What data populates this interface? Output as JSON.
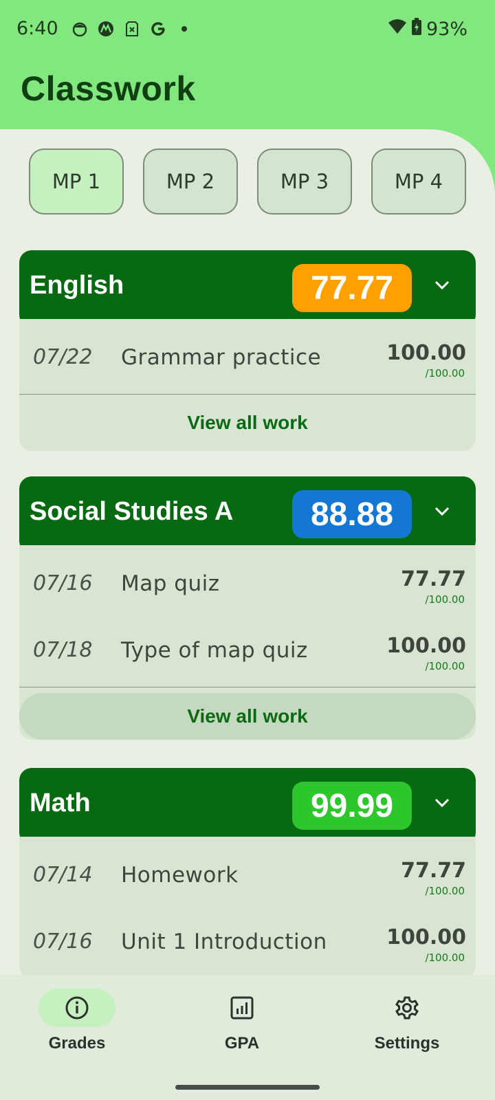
{
  "status_bar": {
    "time": "6:40",
    "battery": "93%",
    "icons": [
      "face-icon",
      "motorola-icon",
      "sim-icon",
      "google-icon",
      "dot-icon"
    ]
  },
  "header": {
    "title": "Classwork"
  },
  "marking_periods": [
    {
      "label": "MP 1",
      "active": true
    },
    {
      "label": "MP 2",
      "active": false
    },
    {
      "label": "MP 3",
      "active": false
    },
    {
      "label": "MP 4",
      "active": false
    }
  ],
  "courses": [
    {
      "name": "English",
      "grade": "77.77",
      "grade_color": "#ffa000",
      "assignments": [
        {
          "date": "07/22",
          "name": "Grammar practice",
          "score": "100.00",
          "out_of": "/100.00"
        }
      ],
      "view_all_label": "View all work"
    },
    {
      "name": "Social Studies A",
      "grade": "88.88",
      "grade_color": "#1477d4",
      "assignments": [
        {
          "date": "07/16",
          "name": "Map quiz",
          "score": "77.77",
          "out_of": "/100.00"
        },
        {
          "date": "07/18",
          "name": "Type of map quiz",
          "score": "100.00",
          "out_of": "/100.00"
        }
      ],
      "view_all_label": "View all work"
    },
    {
      "name": "Math",
      "grade": "99.99",
      "grade_color": "#2dc72d",
      "assignments": [
        {
          "date": "07/14",
          "name": "Homework",
          "score": "77.77",
          "out_of": "/100.00"
        },
        {
          "date": "07/16",
          "name": "Unit 1 Introduction",
          "score": "100.00",
          "out_of": "/100.00"
        }
      ]
    }
  ],
  "bottom_nav": [
    {
      "label": "Grades",
      "icon": "info-icon",
      "active": true
    },
    {
      "label": "GPA",
      "icon": "chart-icon",
      "active": false
    },
    {
      "label": "Settings",
      "icon": "gear-icon",
      "active": false
    }
  ],
  "colors": {
    "header_bg": "#83e77f",
    "card_header": "#076a12",
    "sheet_bg": "#eaefe4"
  }
}
